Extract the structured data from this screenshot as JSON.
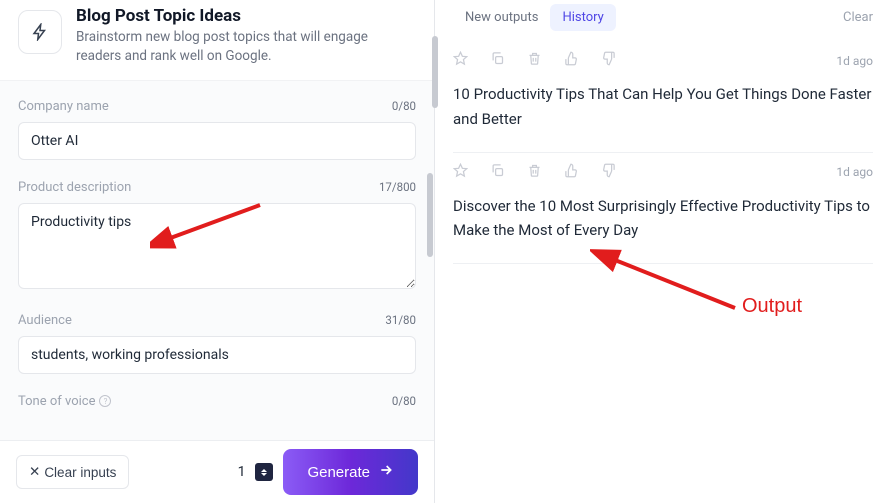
{
  "header": {
    "title": "Blog Post Topic Ideas",
    "subtitle": "Brainstorm new blog post topics that will engage readers and rank well on Google."
  },
  "form": {
    "company": {
      "label": "Company name",
      "value": "Otter AI",
      "count": "0/80"
    },
    "description": {
      "label": "Product description",
      "value": "Productivity tips",
      "count": "17/800"
    },
    "audience": {
      "label": "Audience",
      "value": "students, working professionals",
      "count": "31/80"
    },
    "tone": {
      "label": "Tone of voice",
      "count": "0/80"
    }
  },
  "footer": {
    "clear": "Clear inputs",
    "qty": "1",
    "generate": "Generate"
  },
  "tabs": {
    "new": "New outputs",
    "history": "History",
    "clear": "Clear"
  },
  "outputs": [
    {
      "time": "1d ago",
      "text": "10 Productivity Tips That Can Help You Get Things Done Faster and Better"
    },
    {
      "time": "1d ago",
      "text": "Discover the 10 Most Surprisingly Effective Productivity Tips to Make the Most of Every Day"
    }
  ],
  "annotation": {
    "output_label": "Output"
  }
}
